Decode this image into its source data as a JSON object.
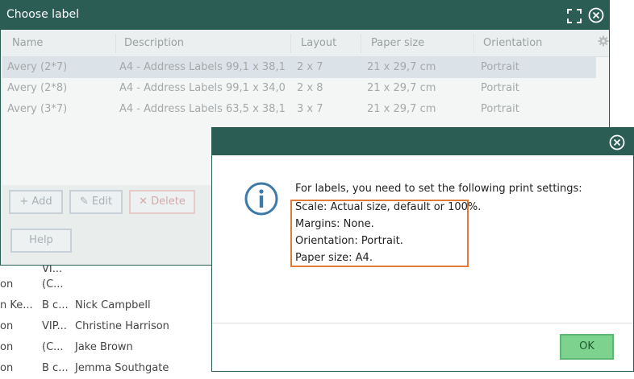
{
  "window": {
    "title": "Choose label",
    "columns": [
      "Name",
      "Description",
      "Layout",
      "Paper size",
      "Orientation"
    ],
    "rows": [
      {
        "name": "Avery (2*7)",
        "description": "A4 - Address Labels 99,1 x 38,1",
        "layout": "2 x 7",
        "paper": "21 x 29,7 cm",
        "orientation": "Portrait"
      },
      {
        "name": "Avery (2*8)",
        "description": "A4 - Address Labels 99,1 x 34,0",
        "layout": "2 x 8",
        "paper": "21 x 29,7 cm",
        "orientation": "Portrait"
      },
      {
        "name": "Avery (3*7)",
        "description": "A4 - Address Labels 63,5 x 38,1",
        "layout": "3 x 7",
        "paper": "21 x 29,7 cm",
        "orientation": "Portrait"
      }
    ],
    "buttons": {
      "add": "+ Add",
      "edit": "Edit",
      "delete": "✕ Delete",
      "help": "Help"
    }
  },
  "background_list": [
    {
      "c1": "",
      "c2": "VI...",
      "c3": ""
    },
    {
      "c1": "on",
      "c2": "(C...",
      "c3": ""
    },
    {
      "c1": "n Ke...",
      "c2": "B c...",
      "c3": "Nick Campbell"
    },
    {
      "c1": "on",
      "c2": "VIP...",
      "c3": "Christine Harrison"
    },
    {
      "c1": "on",
      "c2": "(C...",
      "c3": "Jake Brown"
    },
    {
      "c1": "on",
      "c2": "B c...",
      "c3": "Jemma Southgate"
    }
  ],
  "dialog": {
    "intro": "For labels, you need to set the following print settings:",
    "settings": [
      "Scale: Actual size, default or 100%.",
      "Margins: None.",
      "Orientation: Portrait.",
      "Paper size: A4."
    ],
    "ok_label": "OK"
  },
  "colors": {
    "title_bar": "#2b5d55",
    "highlight": "#e07b39",
    "ok": "#7dd38e",
    "info": "#3e7aa8"
  }
}
